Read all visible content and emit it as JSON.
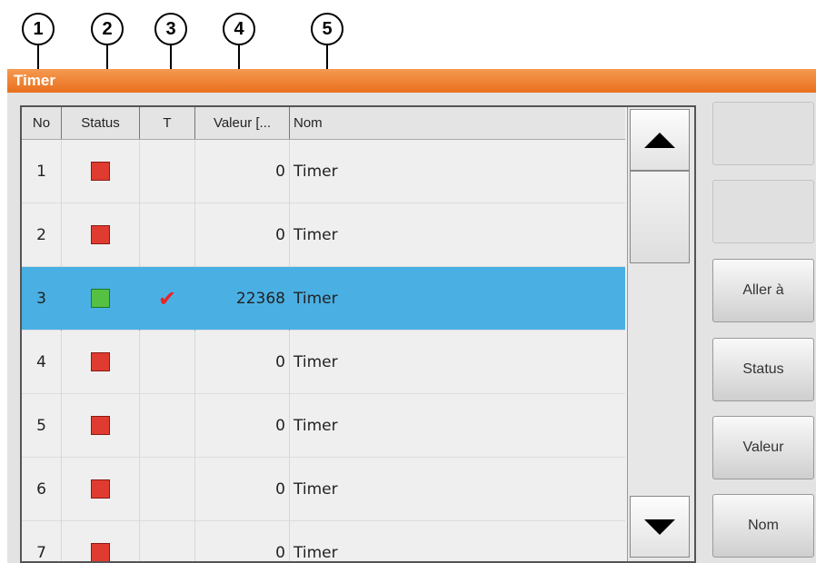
{
  "callouts": [
    "1",
    "2",
    "3",
    "4",
    "5"
  ],
  "window": {
    "title": "Timer"
  },
  "table": {
    "columns": [
      "No",
      "Status",
      "T",
      "Valeur [...",
      "Nom"
    ],
    "rows": [
      {
        "no": "1",
        "status": "red",
        "t": "",
        "value": "0",
        "name": "Timer"
      },
      {
        "no": "2",
        "status": "red",
        "t": "",
        "value": "0",
        "name": "Timer"
      },
      {
        "no": "3",
        "status": "green",
        "t": "✔",
        "value": "22368",
        "name": "Timer",
        "selected": true
      },
      {
        "no": "4",
        "status": "red",
        "t": "",
        "value": "0",
        "name": "Timer"
      },
      {
        "no": "5",
        "status": "red",
        "t": "",
        "value": "0",
        "name": "Timer"
      },
      {
        "no": "6",
        "status": "red",
        "t": "",
        "value": "0",
        "name": "Timer"
      },
      {
        "no": "7",
        "status": "red",
        "t": "",
        "value": "0",
        "name": "Timer"
      }
    ]
  },
  "buttons": {
    "blank1": "",
    "blank2": "",
    "goto": "Aller à",
    "status": "Status",
    "value": "Valeur",
    "name": "Nom"
  },
  "colors": {
    "titlebar": "#e96f1c",
    "selected_row": "#4ab0e4",
    "status_off": "#e03b30",
    "status_on": "#56c043",
    "check": "#e22222"
  },
  "icons": {
    "scroll_up": "triangle-up-icon",
    "scroll_down": "triangle-down-icon",
    "checkmark": "check-icon"
  }
}
